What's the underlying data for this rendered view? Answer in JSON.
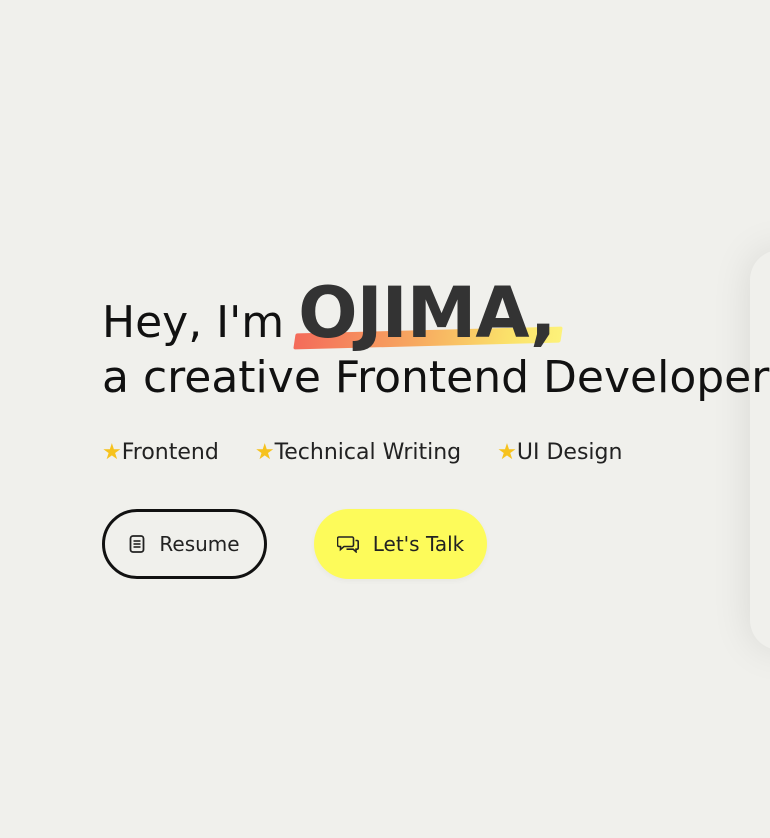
{
  "hero": {
    "greeting": "Hey, I'm",
    "name": "OJIMA,",
    "tagline": "a creative Frontend Developer"
  },
  "skills": [
    {
      "label": "Frontend",
      "icon": "star-icon"
    },
    {
      "label": "Technical Writing",
      "icon": "star-icon"
    },
    {
      "label": "UI Design",
      "icon": "star-icon"
    }
  ],
  "buttons": {
    "resume": {
      "label": "Resume",
      "icon": "document-icon"
    },
    "talk": {
      "label": "Let's Talk",
      "icon": "chat-bubbles-icon"
    }
  },
  "colors": {
    "background": "#f0f0ec",
    "accent_yellow": "#fdfb5a",
    "star": "#f6c21d",
    "highlight_start": "#f46b5a",
    "highlight_end": "#fdf27a"
  }
}
